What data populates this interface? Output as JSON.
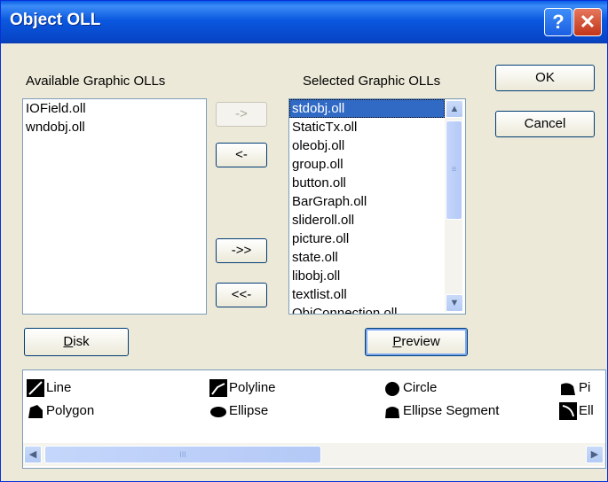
{
  "window": {
    "title": "Object OLL",
    "help_glyph": "?",
    "close_glyph": "✕"
  },
  "available": {
    "label": "Available Graphic OLLs",
    "items": [
      "IOField.oll",
      "wndobj.oll"
    ]
  },
  "selected": {
    "label": "Selected Graphic OLLs",
    "items": [
      "stdobj.oll",
      "StaticTx.oll",
      "oleobj.oll",
      "group.oll",
      "button.oll",
      "BarGraph.oll",
      "slideroll.oll",
      "picture.oll",
      "state.oll",
      "libobj.oll",
      "textlist.oll",
      "ObjConnection.oll"
    ]
  },
  "buttons": {
    "ok": "OK",
    "cancel": "Cancel",
    "add": "->",
    "remove": "<-",
    "add_all": "->>",
    "remove_all": "<<-",
    "disk_prefix": "D",
    "disk_rest": "isk",
    "preview_prefix": "P",
    "preview_rest": "review"
  },
  "preview_items": [
    {
      "label": "Line",
      "icon": "line-icon"
    },
    {
      "label": "Polyline",
      "icon": "polyline-icon"
    },
    {
      "label": "Circle",
      "icon": "circle-icon"
    },
    {
      "label": "Pi",
      "icon": "pie-icon"
    },
    {
      "label": "Polygon",
      "icon": "polygon-icon"
    },
    {
      "label": "Ellipse",
      "icon": "ellipse-icon"
    },
    {
      "label": "Ellipse Segment",
      "icon": "ellipse-segment-icon"
    },
    {
      "label": "Ell",
      "icon": "ellipse-arc-icon"
    }
  ],
  "scroll": {
    "up": "▲",
    "down": "▼",
    "left": "◀",
    "right": "▶",
    "grip_v": "≡",
    "grip_h": "III"
  }
}
